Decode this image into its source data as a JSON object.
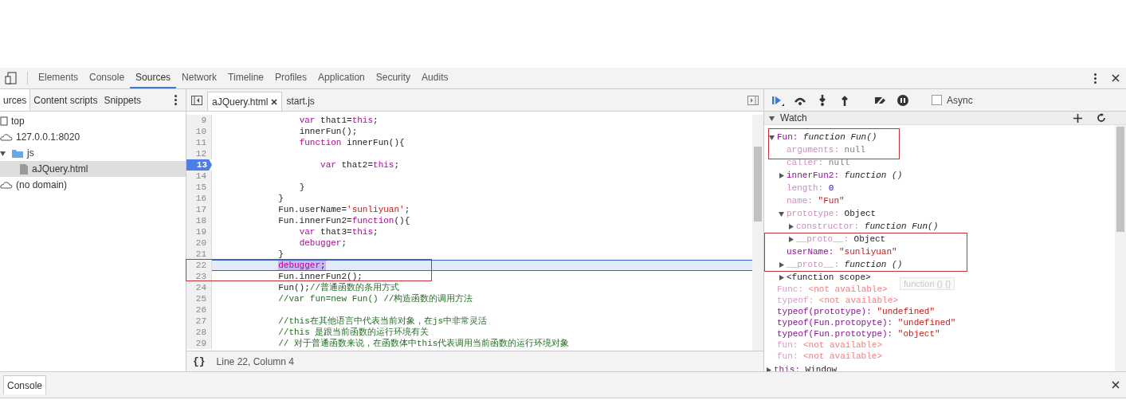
{
  "toolbar": {
    "tabs": [
      {
        "label": "Elements",
        "selected": false
      },
      {
        "label": "Console",
        "selected": false
      },
      {
        "label": "Sources",
        "selected": true
      },
      {
        "label": "Network",
        "selected": false
      },
      {
        "label": "Timeline",
        "selected": false
      },
      {
        "label": "Profiles",
        "selected": false
      },
      {
        "label": "Application",
        "selected": false
      },
      {
        "label": "Security",
        "selected": false
      },
      {
        "label": "Audits",
        "selected": false
      }
    ]
  },
  "navigator": {
    "tabs": [
      {
        "label": "urces",
        "selected": true
      },
      {
        "label": "Content scripts",
        "selected": false
      },
      {
        "label": "Snippets",
        "selected": false
      }
    ],
    "tree": [
      {
        "kind": "frame",
        "label": "top",
        "selected": false
      },
      {
        "kind": "domain",
        "label": "127.0.0.1:8020",
        "selected": false,
        "children": [
          {
            "kind": "folder",
            "label": "js",
            "selected": false,
            "expanded": true,
            "children": [
              {
                "kind": "file",
                "label": "aJQuery.html",
                "selected": true
              }
            ]
          }
        ]
      },
      {
        "kind": "domain",
        "label": "(no domain)",
        "selected": false
      }
    ]
  },
  "editor": {
    "tabs": [
      {
        "label": "aJQuery.html",
        "selected": true,
        "closable": true
      },
      {
        "label": "start.js",
        "selected": false,
        "closable": false
      }
    ],
    "lines": [
      {
        "number": "9",
        "breakpoint": false,
        "paused": false,
        "tokens": [
          {
            "kind": "keyword",
            "text": "                var"
          },
          {
            "kind": "plain",
            "text": " that1="
          },
          {
            "kind": "keyword",
            "text": "this"
          },
          {
            "kind": "plain",
            "text": ";"
          }
        ]
      },
      {
        "number": "10",
        "breakpoint": false,
        "paused": false,
        "tokens": [
          {
            "kind": "plain",
            "text": "                innerFun();"
          }
        ]
      },
      {
        "number": "11",
        "breakpoint": false,
        "paused": false,
        "tokens": [
          {
            "kind": "keyword",
            "text": "                function"
          },
          {
            "kind": "plain",
            "text": " innerFun(){"
          }
        ]
      },
      {
        "number": "12",
        "breakpoint": false,
        "paused": false
      },
      {
        "number": "13",
        "breakpoint": true,
        "paused": false,
        "tokens": [
          {
            "kind": "keyword",
            "text": "                    var"
          },
          {
            "kind": "plain",
            "text": " that2="
          },
          {
            "kind": "keyword",
            "text": "this"
          },
          {
            "kind": "plain",
            "text": ";"
          }
        ]
      },
      {
        "number": "14",
        "breakpoint": false,
        "paused": false
      },
      {
        "number": "15",
        "breakpoint": false,
        "paused": false,
        "tokens": [
          {
            "kind": "plain",
            "text": "                }"
          }
        ]
      },
      {
        "number": "16",
        "breakpoint": false,
        "paused": false,
        "tokens": [
          {
            "kind": "plain",
            "text": "            }"
          }
        ]
      },
      {
        "number": "17",
        "breakpoint": false,
        "paused": false,
        "tokens": [
          {
            "kind": "plain",
            "text": "            Fun.userName="
          },
          {
            "kind": "string",
            "text": "'sunliyuan'"
          },
          {
            "kind": "plain",
            "text": ";"
          }
        ]
      },
      {
        "number": "18",
        "breakpoint": false,
        "paused": false,
        "tokens": [
          {
            "kind": "plain",
            "text": "            Fun.innerFun2="
          },
          {
            "kind": "keyword",
            "text": "function"
          },
          {
            "kind": "plain",
            "text": "(){"
          }
        ]
      },
      {
        "number": "19",
        "breakpoint": false,
        "paused": false,
        "tokens": [
          {
            "kind": "keyword",
            "text": "                var"
          },
          {
            "kind": "plain",
            "text": " that3="
          },
          {
            "kind": "keyword",
            "text": "this"
          },
          {
            "kind": "plain",
            "text": ";"
          }
        ]
      },
      {
        "number": "20",
        "breakpoint": false,
        "paused": false,
        "tokens": [
          {
            "kind": "keyword",
            "text": "                debugger"
          },
          {
            "kind": "plain",
            "text": ";"
          }
        ]
      },
      {
        "number": "21",
        "breakpoint": false,
        "paused": false,
        "tokens": [
          {
            "kind": "plain",
            "text": "            }"
          }
        ]
      },
      {
        "number": "22",
        "breakpoint": false,
        "paused": true,
        "tokens": [
          {
            "kind": "keyword",
            "text": "            debugger"
          },
          {
            "kind": "plain",
            "text": ";"
          }
        ]
      },
      {
        "number": "23",
        "breakpoint": false,
        "paused": false,
        "tokens": [
          {
            "kind": "plain",
            "text": "            Fun.innerFun2();"
          }
        ]
      },
      {
        "number": "24",
        "breakpoint": false,
        "paused": false,
        "tokens": [
          {
            "kind": "plain",
            "text": "            Fun();"
          },
          {
            "kind": "comment",
            "text": "//普通函数的条用方式"
          }
        ]
      },
      {
        "number": "25",
        "breakpoint": false,
        "paused": false,
        "tokens": [
          {
            "kind": "comment",
            "text": "            //var fun=new Fun() //构造函数的调用方法"
          }
        ]
      },
      {
        "number": "26",
        "breakpoint": false,
        "paused": false
      },
      {
        "number": "27",
        "breakpoint": false,
        "paused": false,
        "tokens": [
          {
            "kind": "comment",
            "text": "            //this在其他语言中代表当前对象，在js中非常灵活"
          }
        ]
      },
      {
        "number": "28",
        "breakpoint": false,
        "paused": false,
        "tokens": [
          {
            "kind": "comment",
            "text": "            //this 是跟当前函数的运行环境有关"
          }
        ]
      },
      {
        "number": "29",
        "breakpoint": false,
        "paused": false,
        "tokens": [
          {
            "kind": "comment",
            "text": "            // 对于普通函数来说，在函数体中this代表调用当前函数的运行环境对象"
          }
        ]
      }
    ],
    "status": {
      "format_button": "{}",
      "position": "Line 22, Column 4"
    }
  },
  "debugger": {
    "async": {
      "label": "Async",
      "checked": false
    },
    "watch": {
      "title": "Watch",
      "expanded": true,
      "items": [
        {
          "name": "Fun:",
          "value": "function Fun()",
          "kind": "function",
          "dimmed": false,
          "expanded": true,
          "children": [
            {
              "name": "arguments:",
              "value": "null",
              "kind": "null",
              "dimmed": true
            },
            {
              "name": "caller:",
              "value": "null",
              "kind": "null",
              "dimmed": true
            },
            {
              "name": "innerFun2:",
              "value": "function ()",
              "kind": "function",
              "dimmed": false,
              "expanded": false
            },
            {
              "name": "length:",
              "value": "0",
              "kind": "number",
              "dimmed": true
            },
            {
              "name": "name:",
              "value": "\"Fun\"",
              "kind": "string",
              "dimmed": true
            },
            {
              "name": "prototype:",
              "value": "Object",
              "kind": "object",
              "dimmed": true,
              "expanded": true,
              "children": [
                {
                  "name": "constructor:",
                  "value": "function Fun()",
                  "kind": "function",
                  "dimmed": true,
                  "expanded": false
                },
                {
                  "name": "__proto__:",
                  "value": "Object",
                  "kind": "object",
                  "dimmed": true,
                  "expanded": false
                }
              ]
            },
            {
              "name": "userName:",
              "value": "\"sunliyuan\"",
              "kind": "string",
              "dimmed": false
            },
            {
              "name": "__proto__:",
              "value": "function ()",
              "kind": "function",
              "dimmed": true,
              "expanded": false
            },
            {
              "name": "<function scope>",
              "kind": "scope",
              "dimmed": false,
              "expanded": false
            }
          ]
        },
        {
          "name": "Func:",
          "value": "<not available>",
          "kind": "unavailable",
          "dimmed": true
        },
        {
          "name": "typeof:",
          "value": "<not available>",
          "kind": "unavailable",
          "dimmed": true
        },
        {
          "name": "typeof(prototype):",
          "value": "\"undefined\"",
          "kind": "string",
          "dimmed": false
        },
        {
          "name": "typeof(Fun.protopyte):",
          "value": "\"undefined\"",
          "kind": "string",
          "dimmed": false
        },
        {
          "name": "typeof(Fun.prototype):",
          "value": "\"object\"",
          "kind": "string",
          "dimmed": false
        },
        {
          "name": "fun:",
          "value": "<not available>",
          "kind": "unavailable",
          "dimmed": true
        },
        {
          "name": "fun:",
          "value": "<not available>",
          "kind": "unavailable",
          "dimmed": true
        }
      ]
    },
    "tooltip": "function () {}",
    "scope": [
      {
        "name": "this:",
        "value": "Window",
        "expanded": false
      }
    ]
  },
  "drawer": {
    "tabs": [
      {
        "label": "Console",
        "selected": true
      }
    ]
  }
}
